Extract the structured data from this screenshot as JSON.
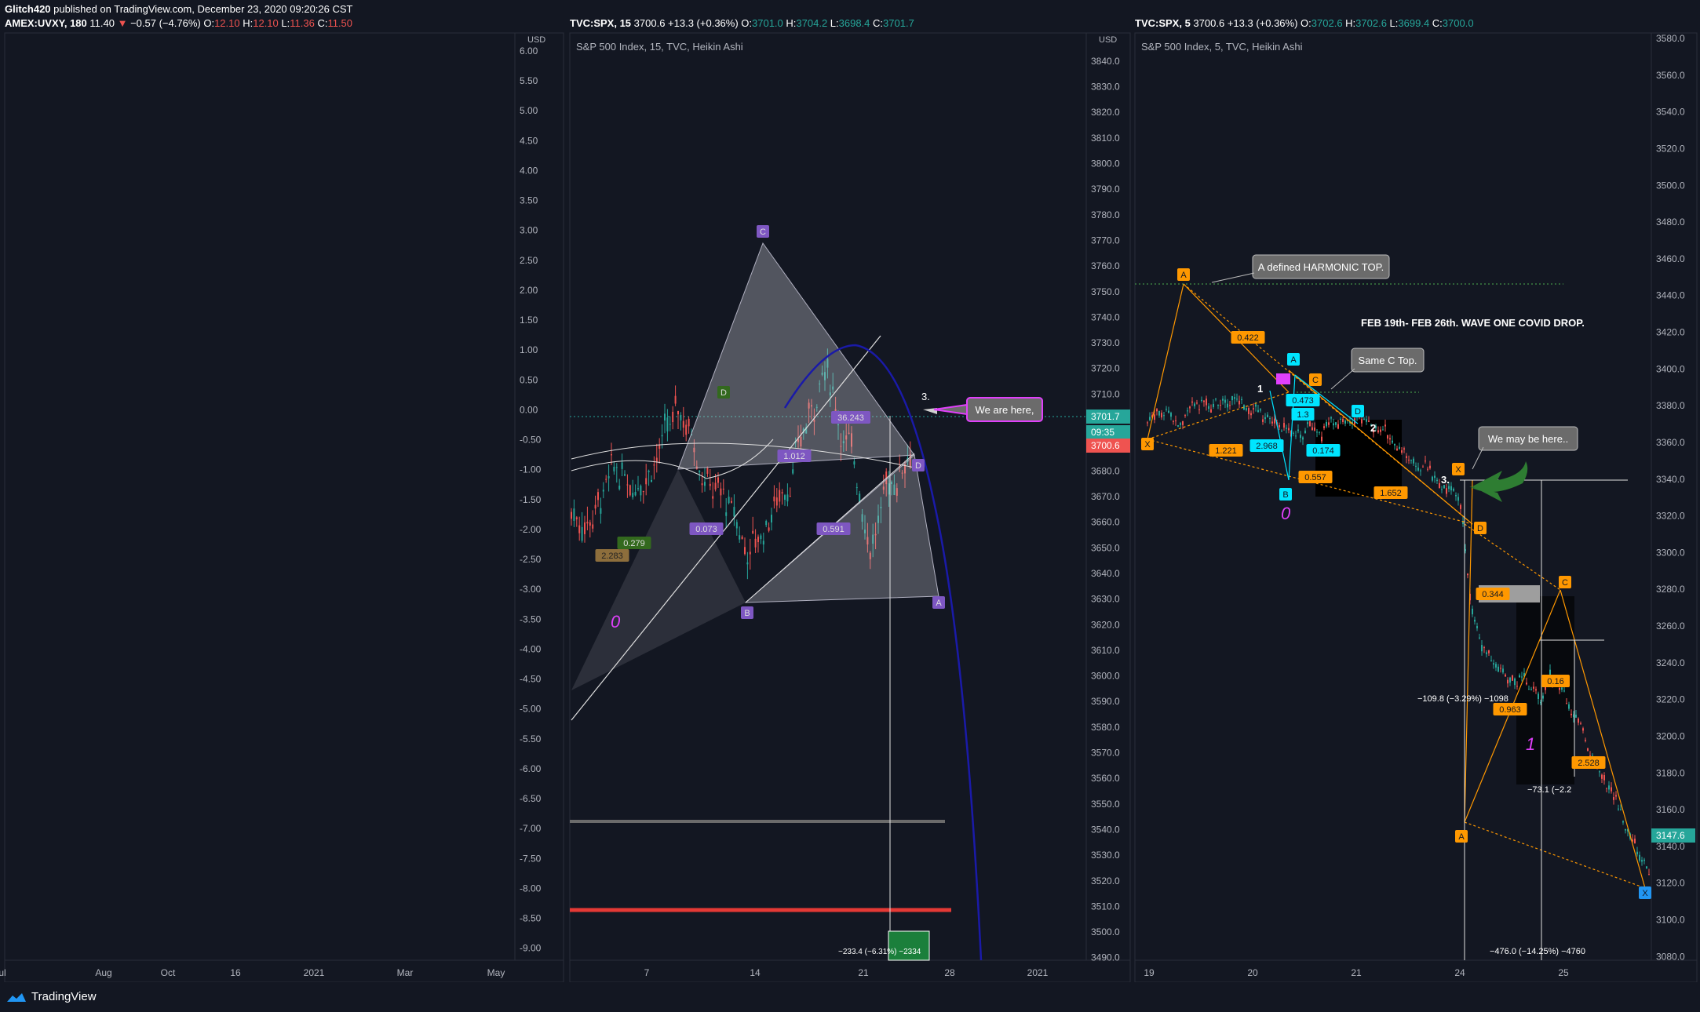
{
  "header": {
    "author": "Glitch420",
    "published": "published on TradingView.com, December 23, 2020 09:20:26 CST"
  },
  "panels": [
    {
      "legend_symbol": "AMEX:UVXY, 180",
      "legend_last": "11.40",
      "legend_change": "−0.57 (−4.76%)",
      "legend_o": "12.10",
      "legend_h": "12.10",
      "legend_l": "11.36",
      "legend_c": "11.50"
    },
    {
      "legend_symbol": "TVC:SPX, 15",
      "legend_last": "3700.6",
      "legend_change": "+13.3 (+0.36%)",
      "legend_o": "3701.0",
      "legend_h": "3704.2",
      "legend_l": "3698.4",
      "legend_c": "3701.7"
    },
    {
      "legend_symbol": "TVC:SPX, 5",
      "legend_last": "3700.6",
      "legend_change": "+13.3 (+0.36%)",
      "legend_o": "3702.6",
      "legend_h": "3702.6",
      "legend_l": "3699.4",
      "legend_c": "3700.0"
    }
  ],
  "chart_data": [
    {
      "type": "line",
      "currency": "USD",
      "y_ticks": [
        "6.00",
        "5.50",
        "5.00",
        "4.50",
        "4.00",
        "3.50",
        "3.00",
        "2.50",
        "2.00",
        "1.50",
        "1.00",
        "0.50",
        "0.00",
        "-0.50",
        "-1.00",
        "-1.50",
        "-2.00",
        "-2.50",
        "-3.00",
        "-3.50",
        "-4.00",
        "-4.50",
        "-5.00",
        "-5.50",
        "-6.00",
        "-6.50",
        "-7.00",
        "-7.50",
        "-8.00",
        "-8.50",
        "-9.00"
      ],
      "x_ticks": [
        "Aug",
        "Oct",
        "16",
        "2021",
        "Mar",
        "May",
        "Jul"
      ],
      "ylim": [
        -9.2,
        6.3
      ]
    },
    {
      "type": "line",
      "subtitle": "S&P 500 Index, 15, TVC, Heikin Ashi",
      "currency": "USD",
      "y_ticks": [
        "3840.0",
        "3830.0",
        "3820.0",
        "3810.0",
        "3800.0",
        "3790.0",
        "3780.0",
        "3770.0",
        "3760.0",
        "3750.0",
        "3740.0",
        "3730.0",
        "3720.0",
        "3710.0",
        "3700.0",
        "3690.0",
        "3680.0",
        "3670.0",
        "3660.0",
        "3650.0",
        "3640.0",
        "3630.0",
        "3620.0",
        "3610.0",
        "3600.0",
        "3590.0",
        "3580.0",
        "3570.0",
        "3560.0",
        "3550.0",
        "3540.0",
        "3530.0",
        "3520.0",
        "3510.0",
        "3500.0",
        "3490.0"
      ],
      "x_ticks": [
        "7",
        "14",
        "21",
        "28",
        "2021"
      ],
      "ylim": [
        3489,
        3851
      ],
      "price_tags": [
        {
          "label": "3701.7",
          "color": "#26a69a"
        },
        {
          "label": "09:35",
          "color": "#26a69a"
        },
        {
          "label": "3700.6",
          "color": "#ef5350"
        }
      ],
      "pattern_points": [
        {
          "label": "C",
          "price": 3771
        },
        {
          "label": "B",
          "price": 3627
        },
        {
          "label": "A",
          "price": 3630
        },
        {
          "label": "D",
          "price": 3684
        },
        {
          "label": "D",
          "price": 3709
        }
      ],
      "ratios": [
        "0.279",
        "2.283",
        "0.073",
        "1.012",
        "0.591",
        "36.243"
      ],
      "annotations": [
        "We are here,",
        "3."
      ],
      "wave_label": "0",
      "measure_label": "−233.4 (−6.31%) −2334"
    },
    {
      "type": "line",
      "subtitle": "S&P 500 Index, 5, TVC, Heikin Ashi",
      "y_ticks": [
        "3580.0",
        "3560.0",
        "3540.0",
        "3520.0",
        "3500.0",
        "3480.0",
        "3460.0",
        "3440.0",
        "3420.0",
        "3400.0",
        "3380.0",
        "3360.0",
        "3340.0",
        "3320.0",
        "3300.0",
        "3280.0",
        "3260.0",
        "3240.0",
        "3220.0",
        "3200.0",
        "3180.0",
        "3160.0",
        "3140.0",
        "3120.0",
        "3100.0",
        "3080.0"
      ],
      "x_ticks": [
        "19",
        "20",
        "21",
        "24",
        "25"
      ],
      "ylim": [
        3078,
        3583
      ],
      "price_tags": [
        {
          "label": "3147.6",
          "color": "#26a69a"
        }
      ],
      "pattern_points": [
        {
          "label": "A",
          "price": 3452
        },
        {
          "label": "X",
          "price": 3363
        },
        {
          "label": "A",
          "price": 3405
        },
        {
          "label": "B",
          "price": 3340
        },
        {
          "label": "C",
          "price": 3399
        },
        {
          "label": "D",
          "price": 3378
        },
        {
          "label": "X",
          "price": 3343
        },
        {
          "label": "D",
          "price": 3321
        },
        {
          "label": "A",
          "price": 3163
        },
        {
          "label": "C",
          "price": 3280
        },
        {
          "label": "X",
          "price": 3117
        }
      ],
      "ratios": [
        "0.422",
        "1.221",
        "2.968",
        "0.473",
        "1.3",
        "0.174",
        "0.557",
        "1.652",
        "0.344",
        "0.963",
        "0.16",
        "2.528"
      ],
      "annotations": [
        "A defined HARMONIC TOP.",
        "Same C Top.",
        "We may be here..",
        "FEB 19th- FEB 26th. WAVE ONE COVID DROP.",
        "1",
        "2",
        "3."
      ],
      "wave_labels": [
        "0",
        "1"
      ],
      "measure_labels": [
        "−109.8 (−3.29%) −1098",
        "−73.1 (−2.2",
        "−476.0 (−14.25%) −4760"
      ]
    }
  ],
  "footer": {
    "brand": "TradingView"
  },
  "colors": {
    "bg": "#131722",
    "up": "#26a69a",
    "down": "#ef5350",
    "pattern": "#7e57c2",
    "orange": "#ff9800",
    "cyan": "#00e5ff"
  }
}
